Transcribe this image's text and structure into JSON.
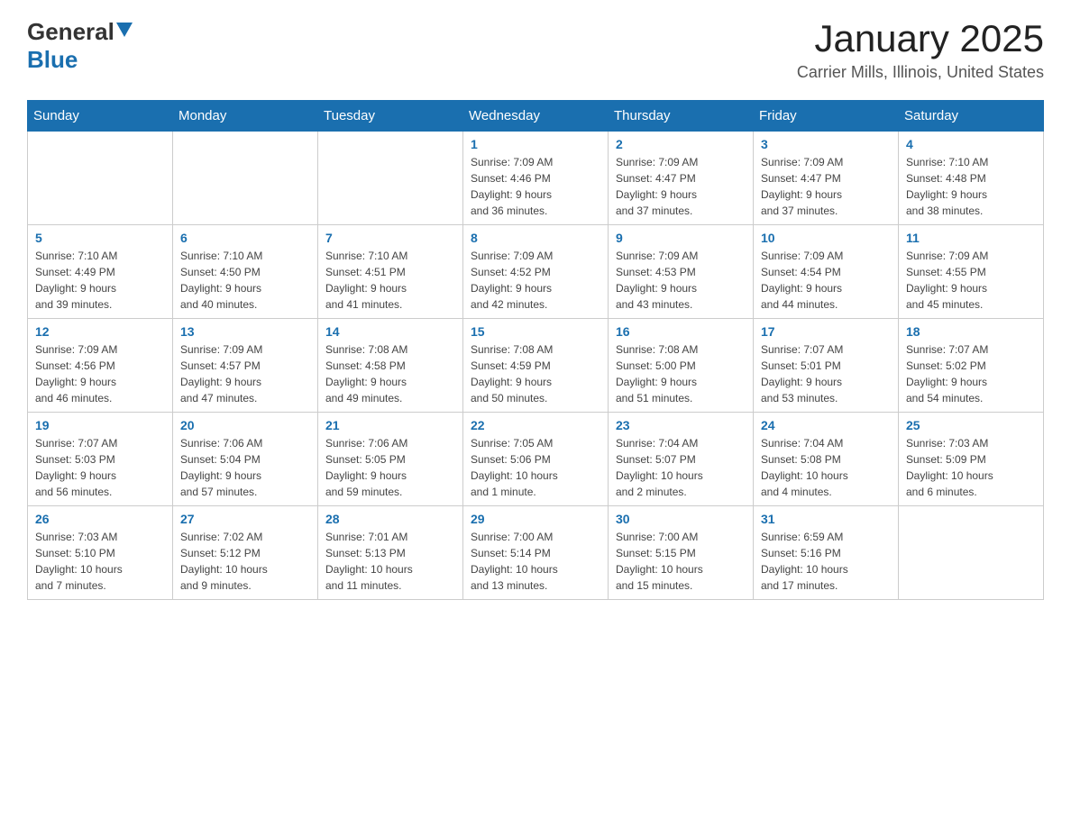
{
  "header": {
    "logo": {
      "general": "General",
      "triangle_symbol": "▲",
      "blue": "Blue"
    },
    "title": "January 2025",
    "subtitle": "Carrier Mills, Illinois, United States"
  },
  "calendar": {
    "days_of_week": [
      "Sunday",
      "Monday",
      "Tuesday",
      "Wednesday",
      "Thursday",
      "Friday",
      "Saturday"
    ],
    "weeks": [
      [
        {
          "day": "",
          "info": ""
        },
        {
          "day": "",
          "info": ""
        },
        {
          "day": "",
          "info": ""
        },
        {
          "day": "1",
          "info": "Sunrise: 7:09 AM\nSunset: 4:46 PM\nDaylight: 9 hours\nand 36 minutes."
        },
        {
          "day": "2",
          "info": "Sunrise: 7:09 AM\nSunset: 4:47 PM\nDaylight: 9 hours\nand 37 minutes."
        },
        {
          "day": "3",
          "info": "Sunrise: 7:09 AM\nSunset: 4:47 PM\nDaylight: 9 hours\nand 37 minutes."
        },
        {
          "day": "4",
          "info": "Sunrise: 7:10 AM\nSunset: 4:48 PM\nDaylight: 9 hours\nand 38 minutes."
        }
      ],
      [
        {
          "day": "5",
          "info": "Sunrise: 7:10 AM\nSunset: 4:49 PM\nDaylight: 9 hours\nand 39 minutes."
        },
        {
          "day": "6",
          "info": "Sunrise: 7:10 AM\nSunset: 4:50 PM\nDaylight: 9 hours\nand 40 minutes."
        },
        {
          "day": "7",
          "info": "Sunrise: 7:10 AM\nSunset: 4:51 PM\nDaylight: 9 hours\nand 41 minutes."
        },
        {
          "day": "8",
          "info": "Sunrise: 7:09 AM\nSunset: 4:52 PM\nDaylight: 9 hours\nand 42 minutes."
        },
        {
          "day": "9",
          "info": "Sunrise: 7:09 AM\nSunset: 4:53 PM\nDaylight: 9 hours\nand 43 minutes."
        },
        {
          "day": "10",
          "info": "Sunrise: 7:09 AM\nSunset: 4:54 PM\nDaylight: 9 hours\nand 44 minutes."
        },
        {
          "day": "11",
          "info": "Sunrise: 7:09 AM\nSunset: 4:55 PM\nDaylight: 9 hours\nand 45 minutes."
        }
      ],
      [
        {
          "day": "12",
          "info": "Sunrise: 7:09 AM\nSunset: 4:56 PM\nDaylight: 9 hours\nand 46 minutes."
        },
        {
          "day": "13",
          "info": "Sunrise: 7:09 AM\nSunset: 4:57 PM\nDaylight: 9 hours\nand 47 minutes."
        },
        {
          "day": "14",
          "info": "Sunrise: 7:08 AM\nSunset: 4:58 PM\nDaylight: 9 hours\nand 49 minutes."
        },
        {
          "day": "15",
          "info": "Sunrise: 7:08 AM\nSunset: 4:59 PM\nDaylight: 9 hours\nand 50 minutes."
        },
        {
          "day": "16",
          "info": "Sunrise: 7:08 AM\nSunset: 5:00 PM\nDaylight: 9 hours\nand 51 minutes."
        },
        {
          "day": "17",
          "info": "Sunrise: 7:07 AM\nSunset: 5:01 PM\nDaylight: 9 hours\nand 53 minutes."
        },
        {
          "day": "18",
          "info": "Sunrise: 7:07 AM\nSunset: 5:02 PM\nDaylight: 9 hours\nand 54 minutes."
        }
      ],
      [
        {
          "day": "19",
          "info": "Sunrise: 7:07 AM\nSunset: 5:03 PM\nDaylight: 9 hours\nand 56 minutes."
        },
        {
          "day": "20",
          "info": "Sunrise: 7:06 AM\nSunset: 5:04 PM\nDaylight: 9 hours\nand 57 minutes."
        },
        {
          "day": "21",
          "info": "Sunrise: 7:06 AM\nSunset: 5:05 PM\nDaylight: 9 hours\nand 59 minutes."
        },
        {
          "day": "22",
          "info": "Sunrise: 7:05 AM\nSunset: 5:06 PM\nDaylight: 10 hours\nand 1 minute."
        },
        {
          "day": "23",
          "info": "Sunrise: 7:04 AM\nSunset: 5:07 PM\nDaylight: 10 hours\nand 2 minutes."
        },
        {
          "day": "24",
          "info": "Sunrise: 7:04 AM\nSunset: 5:08 PM\nDaylight: 10 hours\nand 4 minutes."
        },
        {
          "day": "25",
          "info": "Sunrise: 7:03 AM\nSunset: 5:09 PM\nDaylight: 10 hours\nand 6 minutes."
        }
      ],
      [
        {
          "day": "26",
          "info": "Sunrise: 7:03 AM\nSunset: 5:10 PM\nDaylight: 10 hours\nand 7 minutes."
        },
        {
          "day": "27",
          "info": "Sunrise: 7:02 AM\nSunset: 5:12 PM\nDaylight: 10 hours\nand 9 minutes."
        },
        {
          "day": "28",
          "info": "Sunrise: 7:01 AM\nSunset: 5:13 PM\nDaylight: 10 hours\nand 11 minutes."
        },
        {
          "day": "29",
          "info": "Sunrise: 7:00 AM\nSunset: 5:14 PM\nDaylight: 10 hours\nand 13 minutes."
        },
        {
          "day": "30",
          "info": "Sunrise: 7:00 AM\nSunset: 5:15 PM\nDaylight: 10 hours\nand 15 minutes."
        },
        {
          "day": "31",
          "info": "Sunrise: 6:59 AM\nSunset: 5:16 PM\nDaylight: 10 hours\nand 17 minutes."
        },
        {
          "day": "",
          "info": ""
        }
      ]
    ]
  }
}
